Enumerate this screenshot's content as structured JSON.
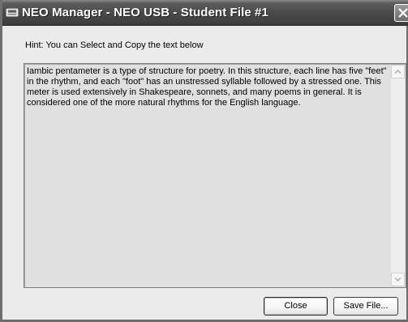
{
  "window": {
    "title": "NEO Manager - NEO USB - Student File #1"
  },
  "icons": {
    "app": "neo-device-icon",
    "close": "close-icon",
    "scroll_up": "scroll-up-arrow-icon",
    "scroll_down": "scroll-down-arrow-icon"
  },
  "hint": "Hint:  You can Select and Copy the text below",
  "file_text": "Iambic pentameter is a type of structure for poetry. In this structure, each line has five \"feet\" in the rhythm, and each \"foot\" has an unstressed syllable followed by a stressed one. This meter is used extensively in Shakespeare, sonnets, and many poems in general. It is considered one of the more natural rhythms for the English language.",
  "buttons": {
    "close": "Close",
    "save": "Save File..."
  }
}
